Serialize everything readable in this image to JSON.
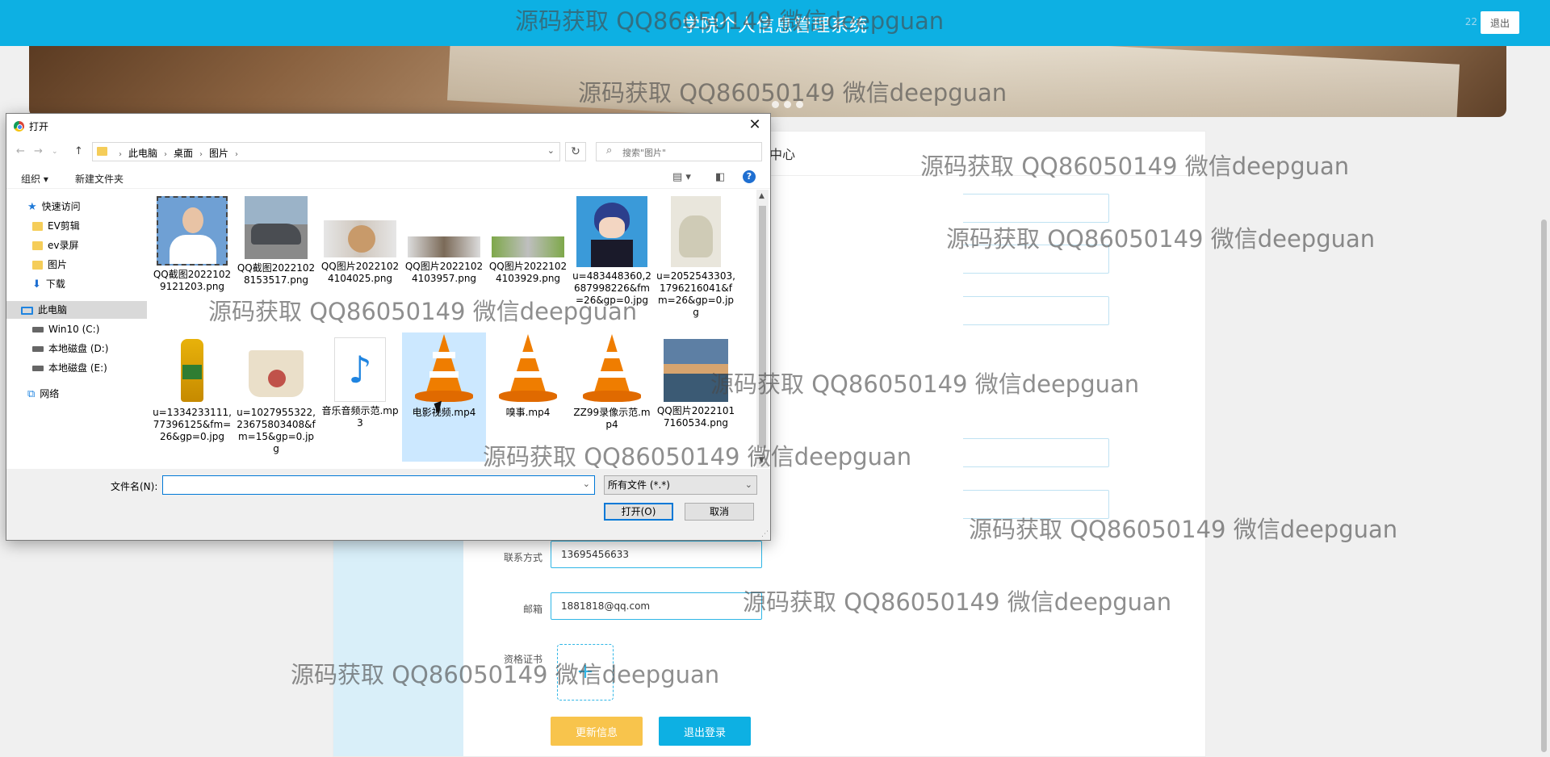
{
  "page": {
    "title": "学院个人信息管理系统",
    "user": "22",
    "logout_label": "退出",
    "section_title": "中心",
    "fields": [
      {
        "label": "联系方式",
        "value": "13695456633"
      },
      {
        "label": "邮箱",
        "value": "1881818@qq.com"
      }
    ],
    "cert_label": "资格证书",
    "upload_icon": "+",
    "update_button": "更新信息",
    "logout_button": "退出登录"
  },
  "dialog": {
    "title": "打开",
    "close_icon": "✕",
    "path": [
      "此电脑",
      "桌面",
      "图片"
    ],
    "search_placeholder": "搜索\"图片\"",
    "organize": "组织 ▾",
    "new_folder": "新建文件夹",
    "help": "?",
    "nav": [
      {
        "label": "快速访问",
        "icon": "star-icon"
      },
      {
        "label": "EV剪辑",
        "icon": "folder-icon"
      },
      {
        "label": "ev录屏",
        "icon": "folder-icon"
      },
      {
        "label": "图片",
        "icon": "folder-icon"
      },
      {
        "label": "下载",
        "icon": "download-icon"
      },
      {
        "label": "此电脑",
        "icon": "computer-icon"
      },
      {
        "label": "Win10 (C:)",
        "icon": "drive-icon"
      },
      {
        "label": "本地磁盘 (D:)",
        "icon": "drive-icon"
      },
      {
        "label": "本地磁盘 (E:)",
        "icon": "drive-icon"
      },
      {
        "label": "网络",
        "icon": "network-icon"
      }
    ],
    "files": [
      {
        "name": "QQ截图20221029121203.png",
        "kind": "portrait"
      },
      {
        "name": "QQ截图20221028153517.png",
        "kind": "car"
      },
      {
        "name": "QQ图片20221024104025.png",
        "kind": "cat"
      },
      {
        "name": "QQ图片20221024103957.png",
        "kind": "cat2"
      },
      {
        "name": "QQ图片20221024103929.png",
        "kind": "grass"
      },
      {
        "name": "u=483448360,2687998226&fm=26&gp=0.jpg",
        "kind": "anime"
      },
      {
        "name": "u=2052543303,1796216041&fm=26&gp=0.jpg",
        "kind": "shoes"
      },
      {
        "name": "u=1334233111,77396125&fm=26&gp=0.jpg",
        "kind": "oil"
      },
      {
        "name": "u=1027955322,23675803408&fm=15&gp=0.jpg",
        "kind": "bag"
      },
      {
        "name": "音乐音频示范.mp3",
        "kind": "music"
      },
      {
        "name": "电影视频.mp4",
        "kind": "vlc"
      },
      {
        "name": "嗅事.mp4",
        "kind": "vlc"
      },
      {
        "name": "ZZ99录像示范.mp4",
        "kind": "vlc"
      },
      {
        "name": "QQ图片20221017160534.png",
        "kind": "landscape"
      }
    ],
    "filename_label": "文件名(N):",
    "filename_value": "",
    "filetype": "所有文件 (*.*)",
    "open_button": "打开(O)",
    "cancel_button": "取消"
  },
  "watermark": "源码获取 QQ86050149 微信deepguan",
  "colors": {
    "topbar": "#0db0e3",
    "update": "#f8c44c",
    "side": "#d9eff9",
    "selection": "#cce8ff"
  }
}
